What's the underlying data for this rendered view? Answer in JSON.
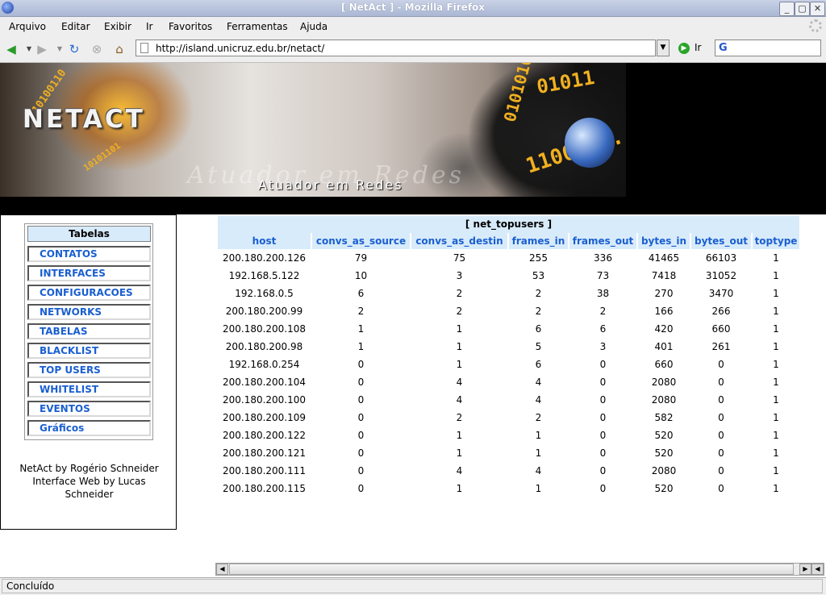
{
  "window": {
    "title": "[ NetAct ] - Mozilla Firefox",
    "minimize": "_",
    "maximize": "▢",
    "close": "✕"
  },
  "menubar": [
    "Arquivo",
    "Editar",
    "Exibir",
    "Ir",
    "Favoritos",
    "Ferramentas",
    "Ajuda"
  ],
  "navbar": {
    "url": "http://island.unicruz.edu.br/netact/",
    "go_label": "Ir",
    "icons": [
      "back-icon",
      "forward-icon",
      "reload-icon",
      "stop-icon",
      "home-icon"
    ]
  },
  "banner": {
    "brand": "NETACT",
    "ghost": "Atuador em Redes",
    "subtitle": "Atuador em Redes"
  },
  "sidebar": {
    "heading": "Tabelas",
    "items": [
      "CONTATOS",
      "INTERFACES",
      "CONFIGURACOES",
      "NETWORKS",
      "TABELAS",
      "BLACKLIST",
      "TOP USERS",
      "WHITELIST",
      "EVENTOS",
      "Gráficos"
    ],
    "credits": [
      "NetAct by Rogério Schneider",
      "Interface Web by Lucas",
      "Schneider"
    ]
  },
  "table": {
    "caption": "[ net_topusers ]",
    "columns": [
      "host",
      "convs_as_source",
      "convs_as_destin",
      "frames_in",
      "frames_out",
      "bytes_in",
      "bytes_out",
      "toptype"
    ],
    "rows": [
      [
        "200.180.200.126",
        "79",
        "75",
        "255",
        "336",
        "41465",
        "66103",
        "1"
      ],
      [
        "192.168.5.122",
        "10",
        "3",
        "53",
        "73",
        "7418",
        "31052",
        "1"
      ],
      [
        "192.168.0.5",
        "6",
        "2",
        "2",
        "38",
        "270",
        "3470",
        "1"
      ],
      [
        "200.180.200.99",
        "2",
        "2",
        "2",
        "2",
        "166",
        "266",
        "1"
      ],
      [
        "200.180.200.108",
        "1",
        "1",
        "6",
        "6",
        "420",
        "660",
        "1"
      ],
      [
        "200.180.200.98",
        "1",
        "1",
        "5",
        "3",
        "401",
        "261",
        "1"
      ],
      [
        "192.168.0.254",
        "0",
        "1",
        "6",
        "0",
        "660",
        "0",
        "1"
      ],
      [
        "200.180.200.104",
        "0",
        "4",
        "4",
        "0",
        "2080",
        "0",
        "1"
      ],
      [
        "200.180.200.100",
        "0",
        "4",
        "4",
        "0",
        "2080",
        "0",
        "1"
      ],
      [
        "200.180.200.109",
        "0",
        "2",
        "2",
        "0",
        "582",
        "0",
        "1"
      ],
      [
        "200.180.200.122",
        "0",
        "1",
        "1",
        "0",
        "520",
        "0",
        "1"
      ],
      [
        "200.180.200.121",
        "0",
        "1",
        "1",
        "0",
        "520",
        "0",
        "1"
      ],
      [
        "200.180.200.111",
        "0",
        "4",
        "4",
        "0",
        "2080",
        "0",
        "1"
      ],
      [
        "200.180.200.115",
        "0",
        "1",
        "1",
        "0",
        "520",
        "0",
        "1"
      ]
    ]
  },
  "statusbar": {
    "text": "Concluído"
  },
  "colors": {
    "header_bg": "#d8ebfb",
    "link": "#1a5fd0"
  }
}
